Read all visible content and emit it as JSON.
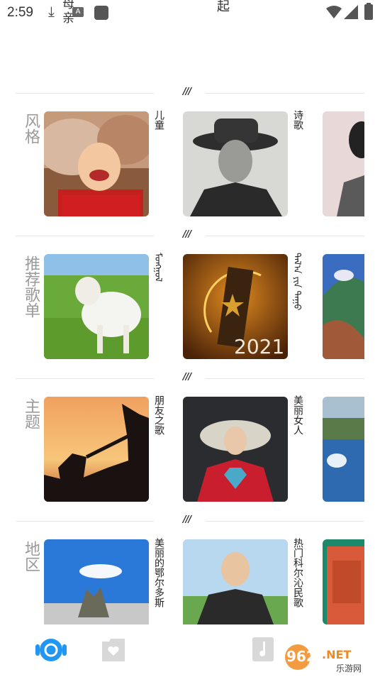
{
  "status_bar": {
    "time": "2:59",
    "notif_text": "母亲",
    "title": "起"
  },
  "section_marker": "///",
  "sections": [
    {
      "title": "风格",
      "cards": [
        {
          "label": "儿童"
        },
        {
          "label": "诗歌"
        }
      ]
    },
    {
      "title": "推荐歌单",
      "cards": [
        {
          "label": "ᠮᠣᠩᠭᠣᠯ"
        },
        {
          "label": "ᠲᠠᠯ᠎ᠠ ᠶᠢᠨ ᠳᠠᠭᠤ"
        }
      ]
    },
    {
      "title": "主题",
      "cards": [
        {
          "label": "朋友之歌"
        },
        {
          "label": "美丽女人"
        }
      ]
    },
    {
      "title": "地区",
      "cards": [
        {
          "label": "美丽的鄂尔多斯"
        },
        {
          "label": "热门科尔沁民歌"
        }
      ]
    }
  ],
  "card2_year": "2021",
  "watermark": {
    "brand": "962",
    "suffix": ".NET",
    "sub": "乐游网"
  },
  "colors": {
    "accent": "#2196f3",
    "title_gray": "#9a9a9a"
  }
}
